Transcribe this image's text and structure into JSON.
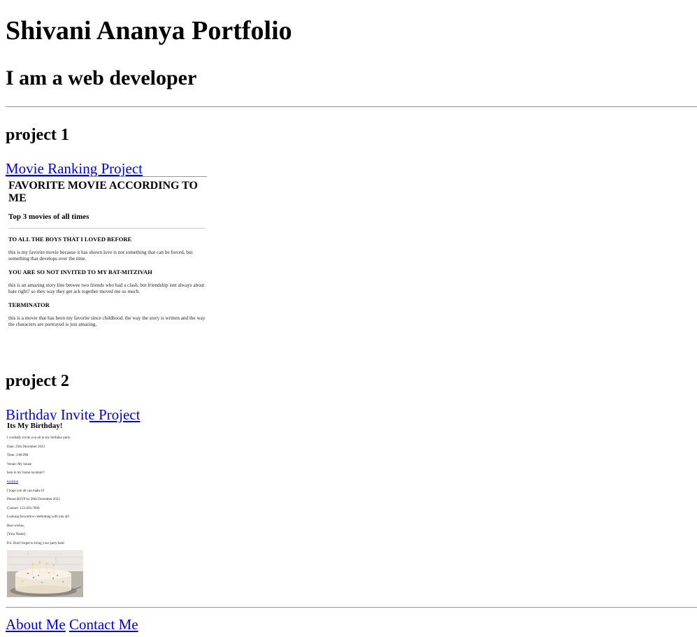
{
  "header": {
    "title": "Shivani Ananya Portfolio",
    "subtitle": "I am a web developer"
  },
  "projects": [
    {
      "heading": "project 1",
      "link_label": "Movie Ranking Project",
      "preview": {
        "title": "FAVORITE MOVIE ACCORDING TO ME",
        "subtitle": "Top 3 movies of all times",
        "movies": [
          {
            "name": "TO ALL THE BOYS THAT I LOVED BEFORE",
            "description": "this is my favorite movie because it has shown love is not something that can be forced, but something that develops over the time."
          },
          {
            "name": "YOU ARE SO NOT INVITED TO MY BAT-MITZIVAH",
            "description": "this is an amazing story line betwee two friends who had a clash. but friendship isnt always about hate right? so they way they get ack together moved me so much."
          },
          {
            "name": "TERMINATOR",
            "description": "this is a movie that has been my favorite since childhood. the way the story is written and the way the characters are portrayed is just amazing."
          }
        ]
      }
    },
    {
      "heading": "project 2",
      "link_label": "Birthday Invite Project",
      "preview": {
        "title": "Its My Birthday!",
        "lines": [
          "I cordially invite you all to my birthday party",
          "Date: 25th December 2023",
          "Time: 3:00 PM",
          "Venue: My house",
          "here is my home location!!",
          "location",
          "I hope you all can make it!",
          "Please RSVP by 20th December 2023",
          "Contact: 123-456-7890",
          "Looking forward to celebrating with you all!",
          "Best wishes,",
          "[Your Name]",
          "P.S. Don't forget to bring your party hats!"
        ]
      }
    }
  ],
  "footer": {
    "about_label": "About Me",
    "contact_label": "Contact Me"
  },
  "colors": {
    "link": "#0000ee",
    "text": "#000000",
    "rule": "#9a9a9a"
  }
}
